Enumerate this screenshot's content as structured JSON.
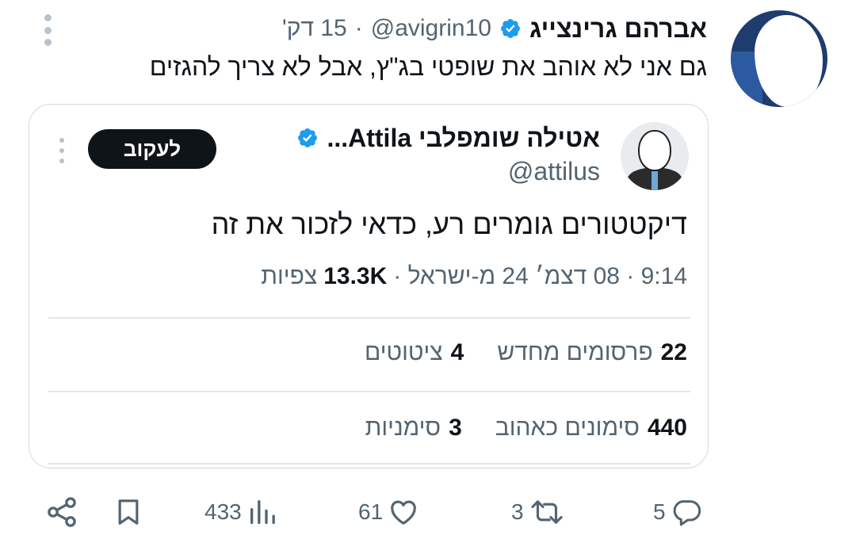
{
  "tweet": {
    "author_name": "אברהם גרינצייג",
    "handle": "@avigrin10",
    "separator": "·",
    "time": "15 דק'",
    "text": "גם אני לא אוהב את שופטי בג\"ץ, אבל לא צריך להגזים",
    "verified": true
  },
  "quote": {
    "author_name": "אטילה שומפלבי Attila...",
    "handle": "@attilus",
    "follow_label": "לעקוב",
    "verified": true,
    "text": "דיקטטורים גומרים רע, כדאי לזכור את זה",
    "meta_time": "9:14 · 08 דצמ׳ 24 מ-ישראל ·",
    "views_count": "13.3K",
    "views_label": "צפיות",
    "reposts_count": "22",
    "reposts_label": "פרסומים מחדש",
    "quotes_count": "4",
    "quotes_label": "ציטוטים",
    "likes_count": "440",
    "likes_label": "סימונים כאהוב",
    "bookmarks_count": "3",
    "bookmarks_label": "סימניות"
  },
  "actions": {
    "replies": "5",
    "retweets": "3",
    "likes": "61",
    "views": "433"
  },
  "colors": {
    "text_primary": "#0f1419",
    "text_secondary": "#536471",
    "verified_blue": "#1d9bf0",
    "border": "#cfd9de"
  },
  "icons": {
    "more": "more-dots-icon",
    "verified": "verified-badge-icon",
    "reply": "reply-icon",
    "retweet": "retweet-icon",
    "like": "heart-icon",
    "views": "views-chart-icon",
    "bookmark": "bookmark-icon",
    "share": "share-icon"
  }
}
